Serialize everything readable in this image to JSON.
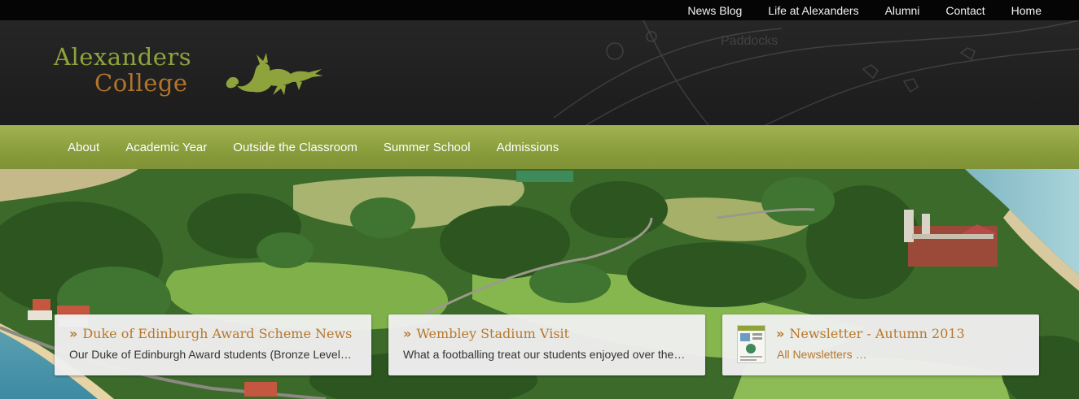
{
  "topnav": [
    "News Blog",
    "Life at Alexanders",
    "Alumni",
    "Contact",
    "Home"
  ],
  "logo": {
    "line1": "Alexanders",
    "line2": "College"
  },
  "header_map_text": "Paddocks",
  "mainnav": [
    "About",
    "Academic Year",
    "Outside the Classroom",
    "Summer School",
    "Admissions"
  ],
  "cards": [
    {
      "title": "Duke of Edinburgh Award Scheme News",
      "text": "Our Duke of Edinburgh  Award students (Bronze Level) had a great expedition"
    },
    {
      "title": "Wembley Stadium Visit",
      "text": "What a footballing treat our students enjoyed over the weekend"
    },
    {
      "title": "Newsletter - Autumn 2013",
      "text": "All Newsletters …"
    }
  ],
  "colors": {
    "brand_green": "#8a9d3b",
    "brand_orange": "#b7782c",
    "topbar": "#050505"
  }
}
